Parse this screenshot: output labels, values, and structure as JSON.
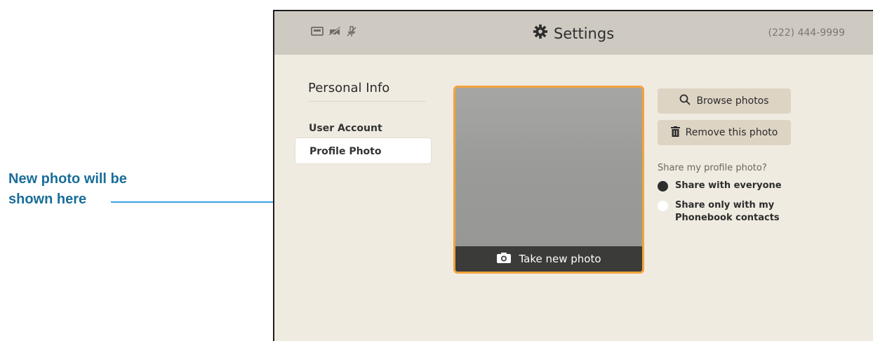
{
  "annotation": {
    "line1": "New photo will be",
    "line2": "shown here",
    "color": "#1a6e98"
  },
  "topbar": {
    "status_icons": [
      "video-icon",
      "camera-off-icon",
      "mic-off-icon"
    ],
    "title": "Settings",
    "title_icon": "gear-icon",
    "phone_number": "(222) 444-9999"
  },
  "menu": {
    "heading": "Personal Info",
    "items": [
      {
        "label": "User Account",
        "selected": false
      },
      {
        "label": "Profile Photo",
        "selected": true
      }
    ]
  },
  "photo": {
    "take_photo_label": "Take new photo",
    "take_photo_icon": "camera-icon",
    "frame_color": "#f2a33c"
  },
  "actions": {
    "browse_label": "Browse photos",
    "browse_icon": "search-icon",
    "remove_label": "Remove this photo",
    "remove_icon": "trash-icon"
  },
  "share": {
    "question": "Share my profile photo?",
    "options": [
      {
        "line1": "Share with everyone",
        "line2": "",
        "selected": true
      },
      {
        "line1": "Share only with my",
        "line2": "Phonebook contacts",
        "selected": false
      }
    ]
  }
}
